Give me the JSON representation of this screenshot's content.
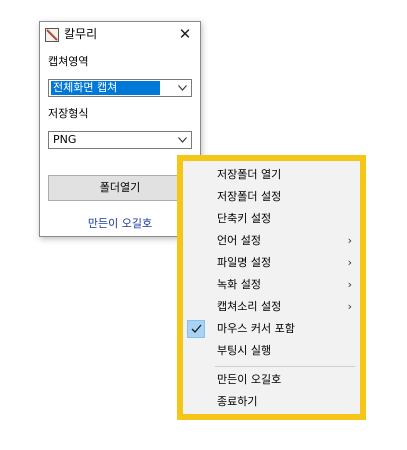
{
  "window": {
    "title": "칼무리",
    "capture_area_label": "캡쳐영역",
    "capture_area_value": "전체화면 캡쳐",
    "save_format_label": "저장형식",
    "save_format_value": "PNG",
    "folder_button": "폴더열기",
    "maker_link": "만든이 오길호"
  },
  "menu": {
    "items": [
      {
        "label": "저장폴더 열기"
      },
      {
        "label": "저장폴더 설정"
      },
      {
        "label": "단축키 설정"
      },
      {
        "label": "언어 설정",
        "submenu": true
      },
      {
        "label": "파일명 설정",
        "submenu": true
      },
      {
        "label": "녹화 설정",
        "submenu": true
      },
      {
        "label": "캡쳐소리 설정",
        "submenu": true
      },
      {
        "label": "마우스 커서 포함",
        "checked": true
      },
      {
        "label": "부팅시 실행"
      },
      {
        "label": "만든이 오길호"
      },
      {
        "label": "종료하기"
      }
    ],
    "submenu_arrow": "›"
  },
  "colors": {
    "highlight": "#f5c518",
    "selection": "#0078d7",
    "check_bg": "#a9d3f5",
    "link": "#1a3aa8"
  }
}
